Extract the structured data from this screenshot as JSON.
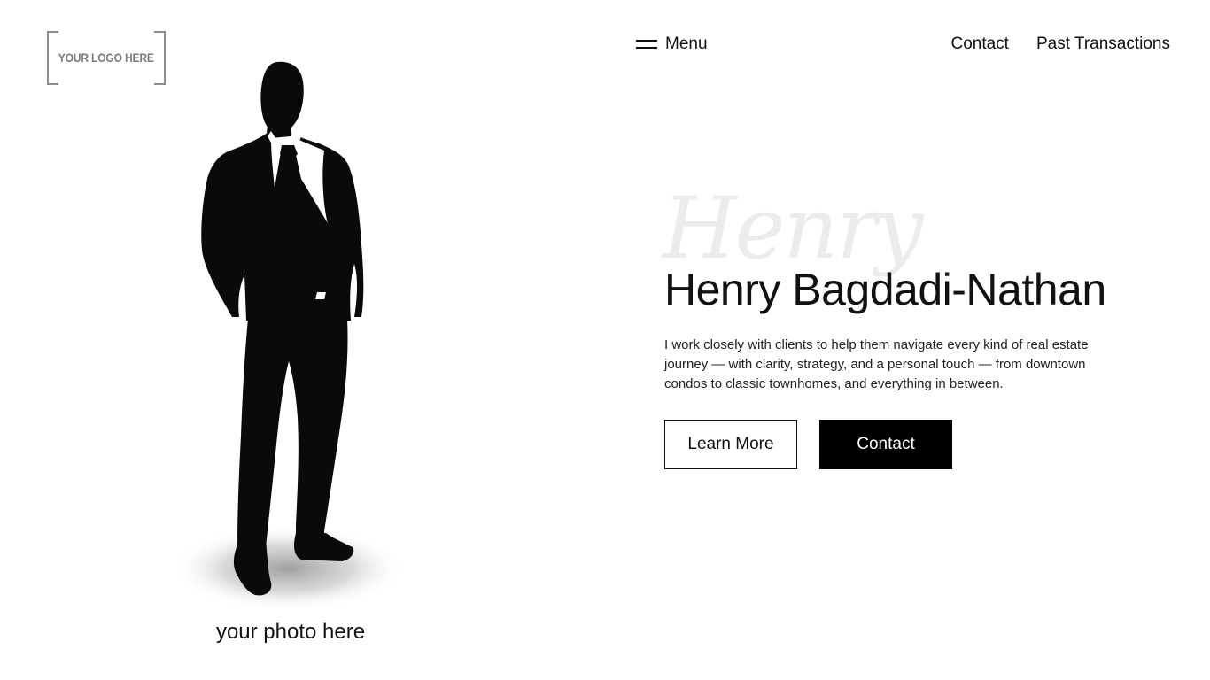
{
  "logo": {
    "text": "YOUR LOGO HERE"
  },
  "nav": {
    "menu_label": "Menu",
    "links": [
      {
        "label": "Contact"
      },
      {
        "label": "Past Transactions"
      }
    ]
  },
  "photo": {
    "caption": "your photo here"
  },
  "hero": {
    "script_name": "Henry",
    "name": "Henry Bagdadi-Nathan",
    "description": "I work closely with clients to help them navigate every kind of real estate journey — with clarity, strategy, and a personal touch — from downtown condos to classic townhomes, and everything in between.",
    "learn_more_label": "Learn More",
    "contact_label": "Contact"
  },
  "colors": {
    "background": "#ffffff",
    "text": "#111111",
    "button_dark": "#000000",
    "script_watermark": "#ececec"
  },
  "icons": {
    "menu": "hamburger-icon"
  }
}
